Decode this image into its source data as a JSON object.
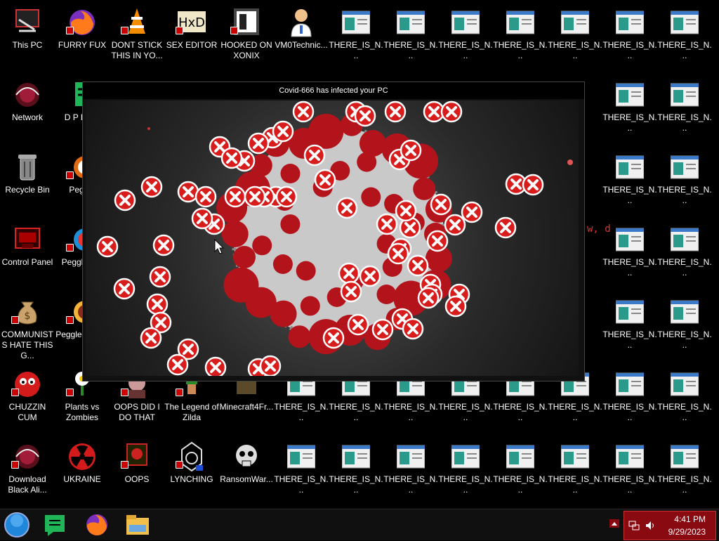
{
  "desktop": {
    "icons": [
      {
        "label": "This PC",
        "icon": "computer-icon"
      },
      {
        "label": "FURRY FUX",
        "icon": "firefox-icon"
      },
      {
        "label": "DONT STICK THIS IN YO...",
        "icon": "vlc-cone-icon"
      },
      {
        "label": "SEX EDITOR",
        "icon": "hex-editor-icon"
      },
      {
        "label": "HOOKED ON XONIX",
        "icon": "xonix-game-icon"
      },
      {
        "label": "VM0Technic...",
        "icon": "doctor-icon"
      },
      {
        "label": "THERE_IS_N...",
        "icon": "window-file-icon"
      },
      {
        "label": "Network",
        "icon": "network-icon"
      },
      {
        "label": "D P DUM",
        "icon": "document-icon"
      },
      {
        "label": "Recycle Bin",
        "icon": "recycle-bin-icon"
      },
      {
        "label": "Peggle",
        "icon": "peggle-icon"
      },
      {
        "label": "Control Panel",
        "icon": "control-panel-icon"
      },
      {
        "label": "Peggle Del",
        "icon": "peggle-icon"
      },
      {
        "label": "COMMUNISTS HATE THIS G...",
        "icon": "money-bag-icon"
      },
      {
        "label": "Peggle of War",
        "icon": "peggle-icon"
      },
      {
        "label": "CHUZZIN CUM",
        "icon": "chuzzle-icon"
      },
      {
        "label": "Plants vs Zombies",
        "icon": "plant-icon"
      },
      {
        "label": "OOPS DID I DO THAT",
        "icon": "portrait-icon"
      },
      {
        "label": "The Legend of Zilda",
        "icon": "zelda-icon"
      },
      {
        "label": "Minecraft4Fr...",
        "icon": "minecraft-icon"
      },
      {
        "label": "Download Black Ali...",
        "icon": "network-icon"
      },
      {
        "label": "UKRAINE",
        "icon": "radiation-icon"
      },
      {
        "label": "OOPS",
        "icon": "red-app-icon"
      },
      {
        "label": "LYNCHING",
        "icon": "lynching-icon"
      },
      {
        "label": "RansomWar...",
        "icon": "skull-icon"
      }
    ],
    "partial_text": "w, d"
  },
  "window": {
    "title": "Covid-666 has infected your PC"
  },
  "taskbar": {
    "buttons": [
      "start-orb-icon",
      "notepad-icon",
      "firefox-icon",
      "file-explorer-icon"
    ],
    "clock_time": "4:41 PM",
    "clock_date": "9/29/2023"
  },
  "colors": {
    "tray_bg": "#8a0a12",
    "virus_spike": "#b3141b",
    "error_red": "#d81b1b"
  }
}
